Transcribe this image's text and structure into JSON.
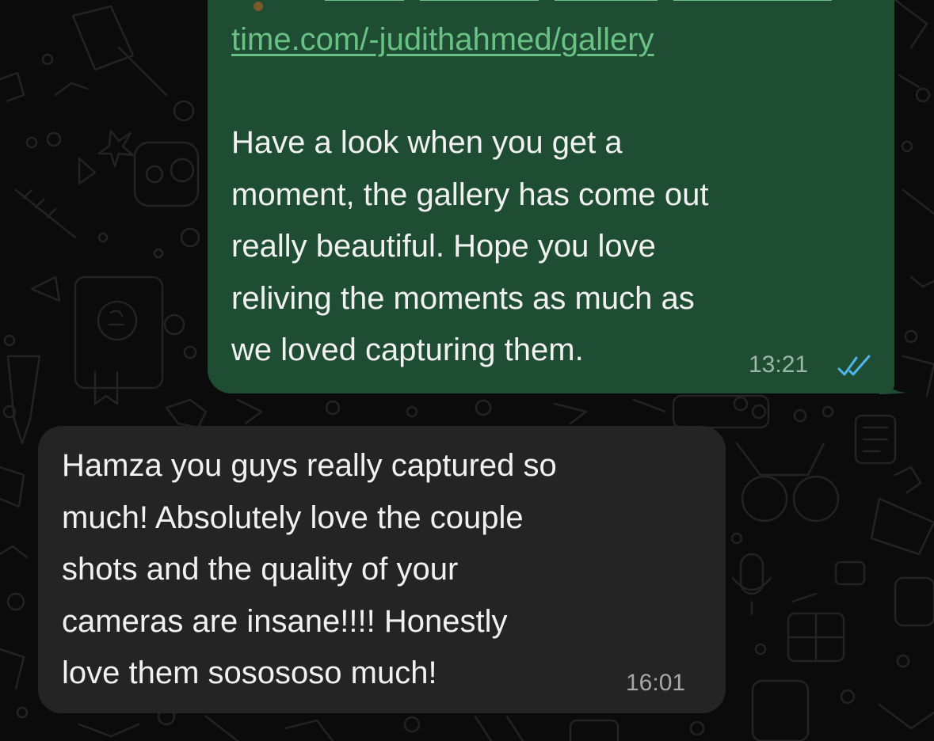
{
  "conversation": {
    "outgoing": {
      "link_text": "time.com/-judithahmed/gallery",
      "text": "Have a look when you get a\nmoment, the gallery has come out\nreally beautiful. Hope you love\nreliving the moments as much as\nwe loved capturing them.",
      "time": "13:21",
      "read_status_icon": "double-check-icon"
    },
    "incoming": {
      "text": "Hamza you guys really captured so\nmuch! Absolutely love the couple\nshots and the quality of your\ncameras are insane!!!! Honestly\nlove them sosososo much!",
      "time": "16:01"
    }
  },
  "colors": {
    "background": "#0b0b0b",
    "outgoing_bubble": "#1f4d34",
    "incoming_bubble": "#242424",
    "link": "#6ac184",
    "read_ticks": "#4fb6ec",
    "message_text": "#f1f1f1"
  }
}
